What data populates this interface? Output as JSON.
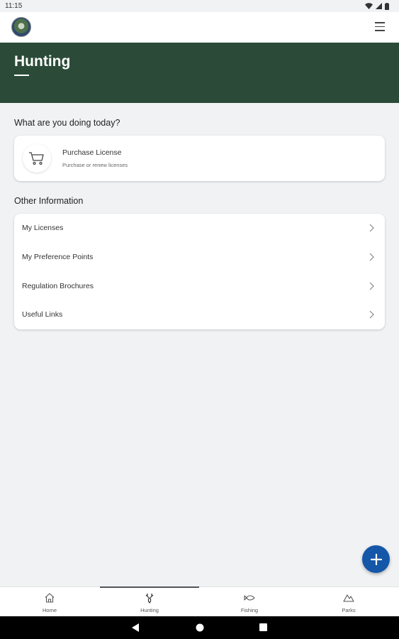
{
  "status": {
    "time": "11:15"
  },
  "header": {
    "title": "Hunting"
  },
  "section1": {
    "title": "What are you doing today?"
  },
  "purchase": {
    "title": "Purchase License",
    "subtitle": "Purchase or renew licenses"
  },
  "section2": {
    "title": "Other Information"
  },
  "links": [
    {
      "label": "My Licenses"
    },
    {
      "label": "My Preference Points"
    },
    {
      "label": "Regulation Brochures"
    },
    {
      "label": "Useful Links"
    }
  ],
  "tabs": [
    {
      "label": "Home",
      "icon": "home-icon"
    },
    {
      "label": "Hunting",
      "icon": "deer-antlers-icon",
      "active": true
    },
    {
      "label": "Fishing",
      "icon": "fish-icon"
    },
    {
      "label": "Parks",
      "icon": "mountain-icon"
    }
  ],
  "colors": {
    "banner": "#2b4b38",
    "fab": "#1456a8",
    "background": "#f0f2f4"
  }
}
